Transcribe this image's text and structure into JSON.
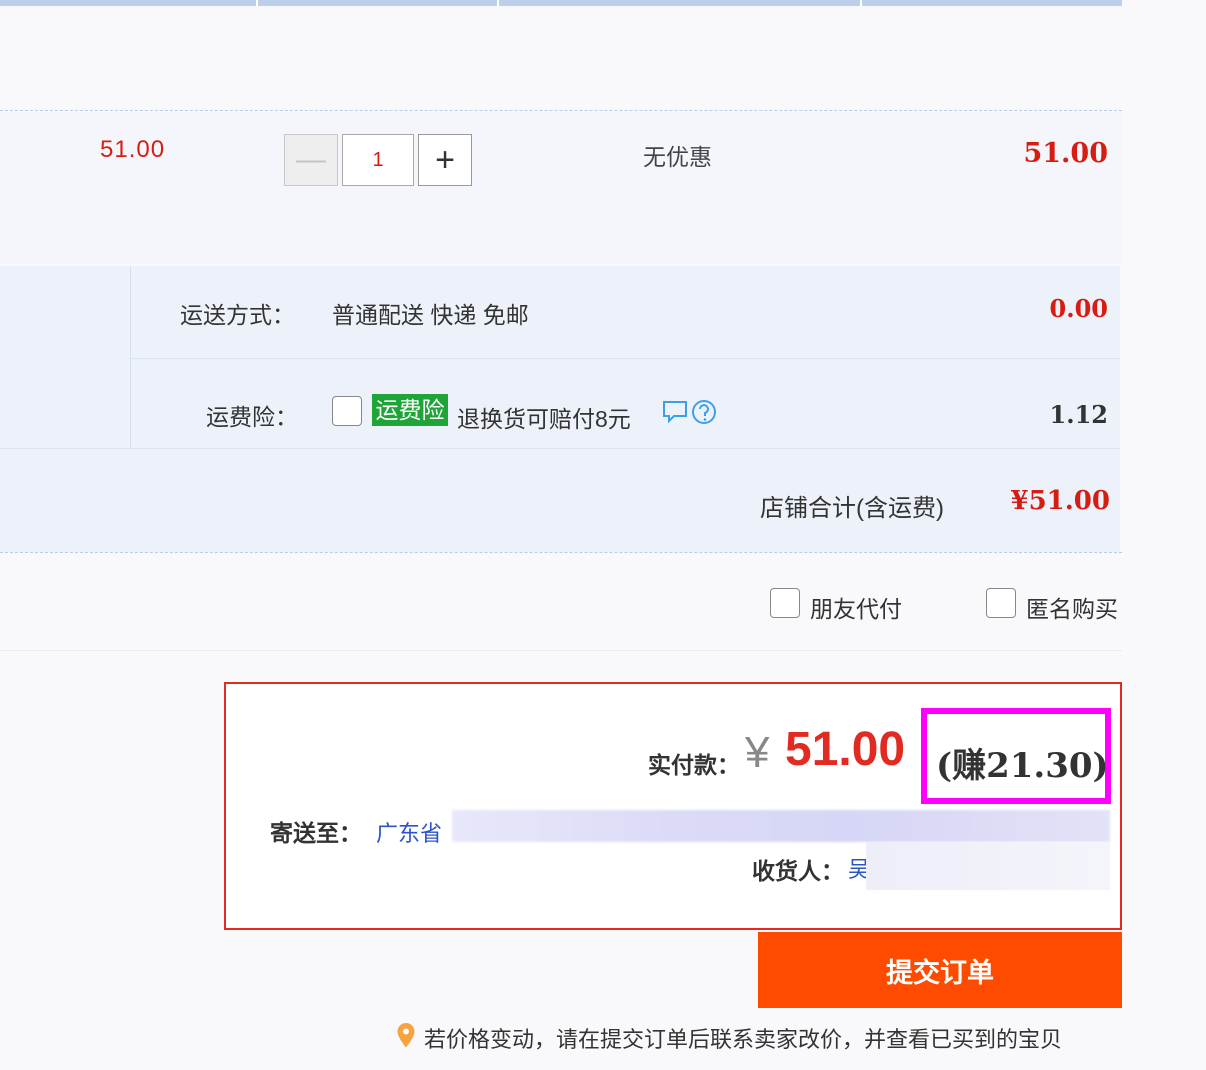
{
  "item": {
    "unit_price": "51.00",
    "qty_minus": "—",
    "quantity": "1",
    "qty_plus": "+",
    "discount": "无优惠",
    "item_total": "51.00"
  },
  "shipping": {
    "method_label": "运送方式：",
    "method_value": "普通配送 快递 免邮",
    "method_cost": "0.00",
    "insurance_label": "运费险：",
    "insurance_tag": "运费险",
    "insurance_desc": "退换货可赔付8元",
    "insurance_cost": "1.12",
    "store_total_label": "店铺合计(含运费)",
    "store_total": "¥51.00"
  },
  "options": {
    "friend_pay": "朋友代付",
    "anonymous": "匿名购买"
  },
  "payment": {
    "label": "实付款：",
    "currency": "¥",
    "amount": "51.00",
    "earn": "(赚21.30)",
    "address_label": "寄送至：",
    "address_province": "广东省",
    "receiver_label": "收货人：",
    "receiver_name": "吴"
  },
  "submit_label": "提交订单",
  "notice": "若价格变动，请在提交订单后联系卖家改价，并查看已买到的宝贝",
  "colors": {
    "price_red": "#d71c12",
    "submit_orange": "#ff4b00",
    "highlight_magenta": "#ff00ff",
    "insurance_green": "#1fa437",
    "link_blue": "#2c54c8"
  }
}
